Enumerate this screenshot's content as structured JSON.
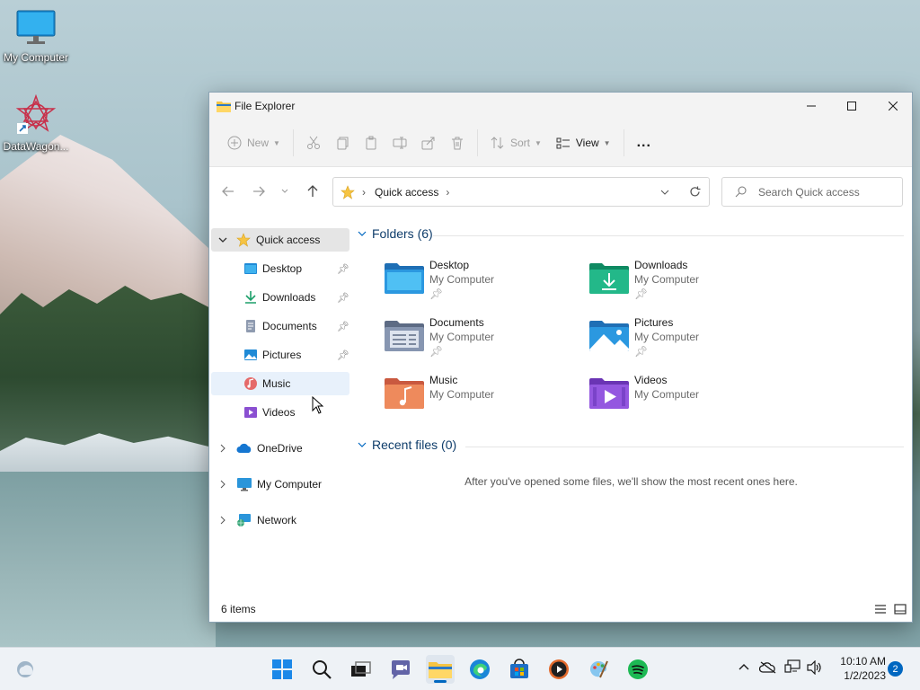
{
  "desktop": {
    "icons": [
      {
        "label": "My Computer"
      },
      {
        "label": "DataWagon..."
      }
    ]
  },
  "window": {
    "title": "File Explorer",
    "toolbar": {
      "new_label": "New",
      "sort_label": "Sort",
      "view_label": "View",
      "more_label": "..."
    },
    "address": {
      "crumb": "Quick access"
    },
    "search": {
      "placeholder": "Search Quick access"
    },
    "sidebar": {
      "quick_access": "Quick access",
      "pinned": [
        {
          "label": "Desktop"
        },
        {
          "label": "Downloads"
        },
        {
          "label": "Documents"
        },
        {
          "label": "Pictures"
        },
        {
          "label": "Music"
        },
        {
          "label": "Videos"
        }
      ],
      "onedrive": "OneDrive",
      "my_computer": "My Computer",
      "network": "Network"
    },
    "folders_header": "Folders (6)",
    "folders": [
      {
        "name": "Desktop",
        "location": "My Computer",
        "pinned": true
      },
      {
        "name": "Downloads",
        "location": "My Computer",
        "pinned": true
      },
      {
        "name": "Documents",
        "location": "My Computer",
        "pinned": true
      },
      {
        "name": "Pictures",
        "location": "My Computer",
        "pinned": true
      },
      {
        "name": "Music",
        "location": "My Computer",
        "pinned": false
      },
      {
        "name": "Videos",
        "location": "My Computer",
        "pinned": false
      }
    ],
    "recent_header": "Recent files (0)",
    "recent_empty": "After you've opened some files, we'll show the most recent ones here.",
    "status": "6 items"
  },
  "taskbar": {
    "time": "10:10 AM",
    "date": "1/2/2023",
    "notification_count": "2"
  },
  "colors": {
    "accent": "#0067c0",
    "folder_yellow": "#f6c443",
    "selection": "#e5e5e5",
    "hover": "#e8f1fb"
  }
}
